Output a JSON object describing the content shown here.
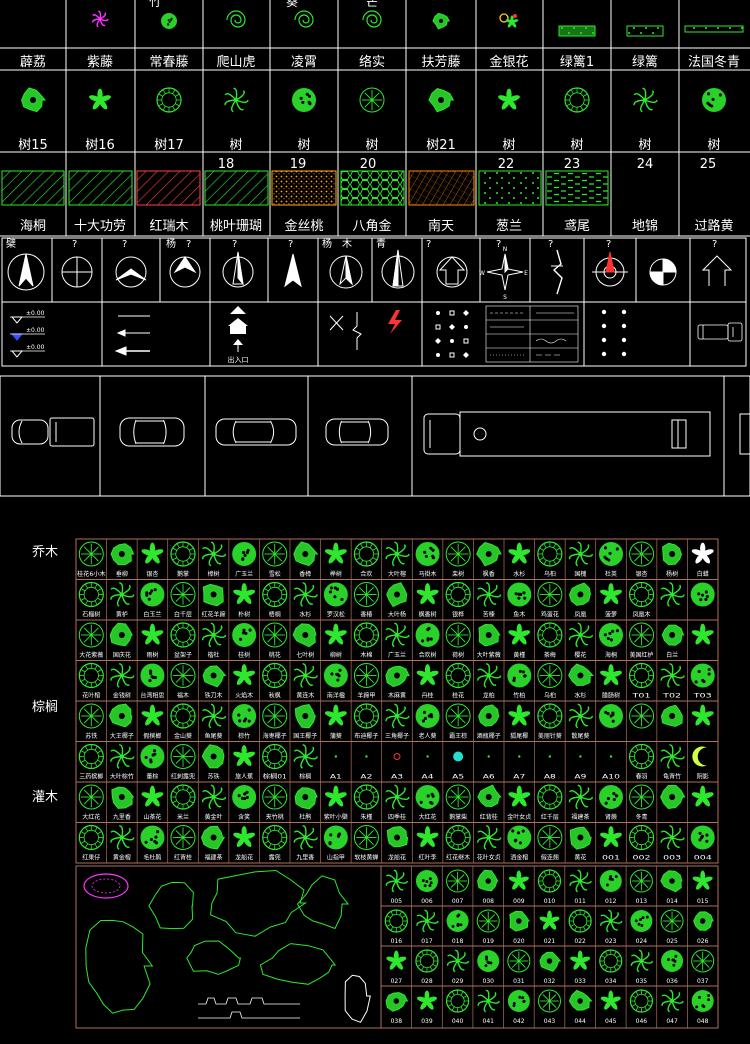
{
  "palette": {
    "background": "#000000",
    "line": "#ffffff",
    "plant_green": "#2ee82e",
    "grid_brown": "#b0705a",
    "magenta": "#ff33ff",
    "yellow": "#ffcc22",
    "red": "#ff3333",
    "cyan": "#22e0d0",
    "hatch_red": "#ff4040",
    "hatch_orange": "#ff8a00"
  },
  "vines": {
    "labels": [
      "薜荔",
      "紫藤",
      "常春藤",
      "爬山虎",
      "凌霄",
      "络实",
      "扶芳藤",
      "金银花",
      "绿篱1",
      "绿篱",
      "法国冬青"
    ],
    "partial_top_labels": [
      "竹",
      "葵",
      "芒"
    ]
  },
  "trees": {
    "top_labels": [
      "树15",
      "树16",
      "树17",
      "树",
      "树",
      "树",
      "树21",
      "树",
      "树",
      "树",
      "树"
    ],
    "bottom_numbers": [
      "18",
      "19",
      "20",
      "22",
      "23",
      "24",
      "25"
    ]
  },
  "hatches": {
    "labels": [
      "海桐",
      "十大功劳",
      "红瑞木",
      "桃叶珊瑚",
      "金丝桃",
      "八角金",
      "南天",
      "葱兰",
      "鸢尾",
      "地锦",
      "过路黄"
    ]
  },
  "north_arrows": {
    "tags": [
      "檗",
      "?",
      "?",
      "杨",
      "?",
      "?",
      "?",
      "杨",
      "木",
      "青",
      "?",
      "?",
      "?",
      "?",
      "?"
    ],
    "compass_letters": [
      "N",
      "E",
      "S",
      "W"
    ]
  },
  "markers": {
    "elevations": [
      "±0.00",
      "±0.00",
      "±0.00"
    ],
    "entrance_label": "出入口"
  },
  "catalog": {
    "side_labels": [
      "乔木",
      "棕榈",
      "灌木"
    ],
    "row_labels": [
      [
        "桂花6小木",
        "垂柳",
        "银杏",
        "鹅掌",
        "樟树",
        "广玉兰",
        "雪松",
        "香樟",
        "榉树",
        "合欢",
        "大叶榕",
        "马褂木",
        "栾树",
        "枫香",
        "水杉",
        "乌桕",
        "国槐",
        "杜英",
        "银杏",
        "杨树",
        "白蜡"
      ],
      [
        "石榴树",
        "黄栌",
        "白玉兰",
        "白千层",
        "红花羊蹄",
        "朴树",
        "梧桐",
        "水杉",
        "罗汉松",
        "香椿",
        "大叶杨",
        "枫香树",
        "银桦",
        "苦楝",
        "鱼木",
        "鸡蛋花",
        "凤凰",
        "菠萝",
        "凤凰木"
      ],
      [
        "大花紫薇",
        "国庆花",
        "雨树",
        "盆架子",
        "楷杜",
        "桂树",
        "桃花",
        "七叶树",
        "柳树",
        "木棉",
        "广玉兰",
        "合欢树",
        "荷树",
        "大叶紫薇",
        "黄槿",
        "茶梅",
        "樱花",
        "海桐",
        "美国红栌",
        "白兰"
      ],
      [
        "花叶榕",
        "金钱树",
        "台湾相思",
        "福木",
        "铁刀木",
        "火焰木",
        "秋枫",
        "黄连木",
        "南洋楹",
        "羊蹄甲",
        "木麻黄",
        "丹桂",
        "桂花",
        "龙柏",
        "竹柏",
        "乌桕",
        "水杉",
        "腊肠树",
        "T01",
        "T02",
        "T03"
      ],
      [
        "苏铁",
        "大王椰子",
        "假槟榔",
        "金山葵",
        "鱼尾葵",
        "棕竹",
        "海枣椰子",
        "国王椰子",
        "蒲葵",
        "布迪椰子",
        "三角椰子",
        "老人葵",
        "霸王棕",
        "酒瓶椰子",
        "狐尾椰",
        "美丽针葵",
        "散尾葵"
      ],
      [
        "三药槟榔",
        "大叶棕竹",
        "董棕",
        "红刺露兜",
        "苏铁",
        "旅人蕉",
        "棕榈01",
        "棕榈",
        "A1",
        "A2",
        "A3",
        "A4",
        "A5",
        "A6",
        "A7",
        "A8",
        "A9",
        "A10",
        "春羽",
        "龟背竹",
        "阴影"
      ],
      [
        "大红花",
        "九里香",
        "山茶花",
        "米兰",
        "黄金叶",
        "含笑",
        "夹竹桃",
        "杜鹃",
        "紫叶小檗",
        "朱槿",
        "四季桂",
        "大红花",
        "鹅掌柴",
        "红背桂",
        "金叶女贞",
        "红千层",
        "福建茶",
        "肾蕨",
        "冬青"
      ],
      [
        "红果仔",
        "黄金榕",
        "毛杜鹃",
        "红背桂",
        "福建茶",
        "龙船花",
        "露兜",
        "九里香",
        "山指甲",
        "软枝黄蝉",
        "龙船花",
        "红叶李",
        "红花继木",
        "花叶女贞",
        "洒金榕",
        "假连翘",
        "黄花",
        "001",
        "002",
        "003",
        "004"
      ]
    ],
    "number_grid": [
      [
        "005",
        "006",
        "007",
        "008",
        "009",
        "010",
        "011",
        "012",
        "013",
        "014",
        "015"
      ],
      [
        "016",
        "017",
        "018",
        "019",
        "020",
        "021",
        "022",
        "023",
        "024",
        "025",
        "026"
      ],
      [
        "027",
        "028",
        "029",
        "030",
        "031",
        "032",
        "033",
        "034",
        "035",
        "036",
        "037"
      ],
      [
        "038",
        "039",
        "040",
        "041",
        "042",
        "043",
        "044",
        "045",
        "046",
        "047",
        "048"
      ]
    ]
  }
}
